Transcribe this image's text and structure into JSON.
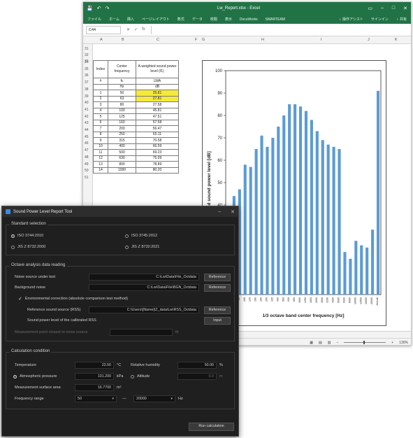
{
  "excel": {
    "title": "Lw_Report.xlsx - Excel",
    "quick_access": [
      "💾",
      "↶",
      "↷"
    ],
    "window_controls": [
      "▭",
      "–",
      "□",
      "✕"
    ],
    "ribbon_tabs": [
      "ファイル",
      "ホーム",
      "挿入",
      "ページレイアウト",
      "数式",
      "データ",
      "校閲",
      "表示",
      "DocuWorks",
      "SMARTEAM",
      "♀ 操作アシスト",
      "サインイン",
      "♀ 共有"
    ],
    "name_box": "C44",
    "formula_icons": [
      "✕",
      "✓",
      "fx"
    ],
    "columns": [
      "A",
      "B",
      "C",
      "F",
      "G",
      "H",
      "I",
      "J",
      "K"
    ],
    "rows": [
      "31",
      "32",
      "33",
      "34",
      "35",
      "36",
      "37",
      "38",
      "39",
      "40",
      "41",
      "42",
      "43",
      "44",
      "45",
      "46",
      "47",
      "48",
      "49",
      "50",
      "51"
    ],
    "table": {
      "headers": [
        "Index",
        "Center frequency",
        "A-weighted sound power level (f1)"
      ],
      "symbols": [
        "#",
        "fc",
        "LWA"
      ],
      "units": [
        "",
        "Hz",
        "dB"
      ],
      "rows": [
        [
          "1",
          "50",
          "25.81"
        ],
        [
          "2",
          "63",
          "27.81"
        ],
        [
          "3",
          "80",
          "27.58"
        ],
        [
          "4",
          "100",
          "45.81"
        ],
        [
          "5",
          "125",
          "47.51"
        ],
        [
          "6",
          "160",
          "57.58"
        ],
        [
          "7",
          "200",
          "56.47"
        ],
        [
          "8",
          "250",
          "65.11"
        ],
        [
          "9",
          "315",
          "70.58"
        ],
        [
          "10",
          "400",
          "66.59"
        ],
        [
          "11",
          "500",
          "69.23"
        ],
        [
          "12",
          "630",
          "75.09"
        ],
        [
          "13",
          "800",
          "78.89"
        ],
        [
          "14",
          "1000",
          "80.20"
        ]
      ]
    },
    "chart_data": {
      "type": "bar",
      "title": "",
      "xlabel": "1/3 octave band center frequency [Hz]",
      "ylabel": "Band sound power level [dB]",
      "ylim": [
        0,
        100
      ],
      "yticks": [
        0,
        10,
        20,
        30,
        40,
        50,
        60,
        70,
        80,
        90,
        100
      ],
      "categories": [
        "50",
        "63",
        "80",
        "100",
        "125",
        "160",
        "200",
        "250",
        "315",
        "400",
        "500",
        "630",
        "800",
        "1000",
        "1250",
        "1600",
        "2000",
        "2500",
        "3150",
        "4000",
        "5000",
        "6300",
        "8000",
        "10000",
        "12500",
        "16000",
        "20000",
        "Overall"
      ],
      "values": [
        37,
        44,
        47,
        58,
        57,
        65,
        71,
        66,
        70,
        75,
        80,
        85,
        85,
        84,
        82,
        78,
        73,
        69,
        67,
        66,
        65,
        19,
        16,
        24,
        22,
        21,
        29,
        91
      ],
      "bar_color": "#5b9bd5"
    },
    "status": {
      "zoom": "130%"
    }
  },
  "dialog": {
    "title": "Sound Power Level Report Tool",
    "window_controls": [
      "–",
      "✕"
    ],
    "standard_selection": {
      "label": "Standard selection",
      "options": [
        "ISO 3744:2010",
        "ISO 3745:2012",
        "JIS Z 8732:2000",
        "JIS Z 8732:2021"
      ],
      "selected": "ISO 3744:2010"
    },
    "octave": {
      "label": "Octave analysis data reading",
      "noise_source_label": "Noise source under test",
      "noise_source_value": "C:\\Lw\\Data\\File_Octdata",
      "background_label": "Background noise",
      "background_value": "C:\\Lw\\Data\\File\\BGN_Octdata",
      "reference_button": "Reference",
      "env_correction_label": "Environmental correction (absolute comparison test method)",
      "rss_label": "Reference sound source (RSS)",
      "rss_value": "C:\\Users\\[Name]\\Z_data\\Lw\\RSS_Octdata",
      "calibrated_label": "Sound power level of the calibrated RSS",
      "input_button": "Input",
      "closest_point_label": "Measurement point closest to noise source",
      "closest_point_unit": "th"
    },
    "calc": {
      "label": "Calculation condition",
      "temperature_label": "Temperature",
      "temperature_value": "23.50",
      "temperature_unit": "°C",
      "humidity_label": "Relative humidity",
      "humidity_value": "50.00",
      "humidity_unit": "%",
      "pressure_label": "Atmospheric pressure",
      "pressure_value": "101.200",
      "pressure_unit": "kPa",
      "altitude_label": "Altitude",
      "altitude_value": "0.0",
      "altitude_unit": "m",
      "surface_label": "Measurement surface area",
      "surface_value": "16.7700",
      "surface_unit": "m²",
      "freq_label": "Frequency range",
      "freq_from": "50",
      "freq_to": "20000",
      "freq_sep": "—",
      "freq_unit": "Hz"
    },
    "run_button": "Run calculation"
  }
}
